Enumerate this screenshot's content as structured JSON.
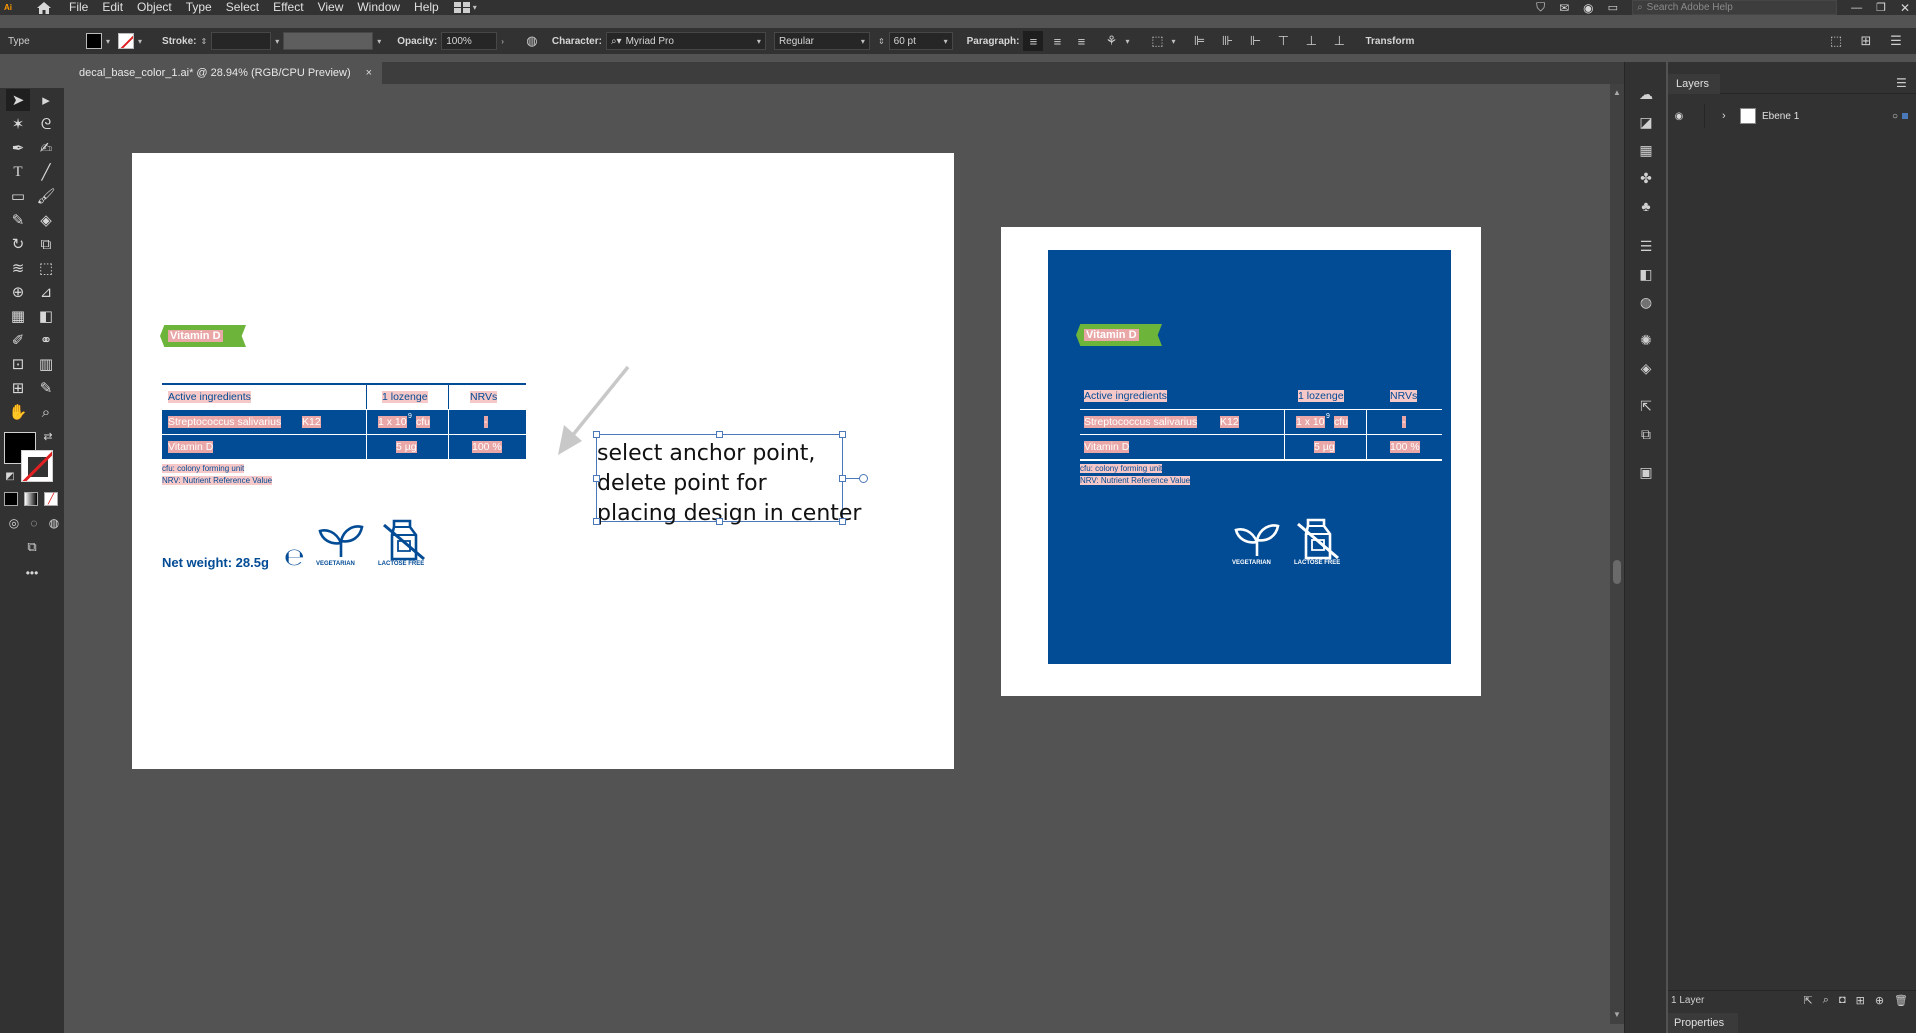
{
  "app": {
    "logo": "Ai",
    "menu": [
      "File",
      "Edit",
      "Object",
      "Type",
      "Select",
      "Effect",
      "View",
      "Window",
      "Help"
    ],
    "search_placeholder": "Search Adobe Help"
  },
  "control_bar": {
    "tool_name": "Type",
    "stroke_label": "Stroke:",
    "opacity_label": "Opacity:",
    "opacity_value": "100%",
    "character_label": "Character:",
    "font_family": "Myriad Pro",
    "font_style": "Regular",
    "font_size": "60 pt",
    "paragraph_label": "Paragraph:",
    "transform_label": "Transform"
  },
  "document": {
    "tab_title": "decal_base_color_1.ai* @ 28.94% (RGB/CPU Preview)",
    "close_glyph": "×"
  },
  "artboard1": {
    "badge": "Vitamin D",
    "table": {
      "headers": [
        "Active ingredients",
        "1 lozenge",
        "NRVs"
      ],
      "rows": [
        [
          "Streptococcus salivarius",
          "K12",
          "1 x 10",
          "9",
          "cfu",
          "‑"
        ],
        [
          "Vitamin D",
          "5 µg",
          "100 %"
        ]
      ]
    },
    "footnote1": "cfu: colony forming unit",
    "footnote2": "NRV: Nutrient Reference Value",
    "net_weight": "Net weight: 28.5g",
    "e_mark": "℮",
    "vegetarian": "VEGETARIAN",
    "lactose_free": "LACTOSE FREE",
    "annotation": [
      "select anchor point,",
      "delete point for",
      "placing design in center"
    ]
  },
  "artboard2": {
    "badge": "Vitamin D",
    "headers": [
      "Active ingredients",
      "1 lozenge",
      "NRVs"
    ],
    "row1": [
      "Streptococcus salivarius",
      "K12",
      "1 x 10",
      "9",
      "cfu",
      "‑"
    ],
    "row2": [
      "Vitamin D",
      "5 µg",
      "100 %"
    ],
    "footnote1": "cfu: colony forming unit",
    "footnote2": "NRV: Nutrient Reference Value",
    "vegetarian": "VEGETARIAN",
    "lactose_free": "LACTOSE FREE"
  },
  "layers_panel": {
    "tab": "Layers",
    "layer_name": "Ebene 1",
    "footer_count": "1 Layer",
    "properties_tab": "Properties"
  },
  "colors": {
    "brand_blue": "#024b95",
    "badge_green": "#6cb53a",
    "ui_dark": "#323232",
    "canvas_gray": "#535353",
    "selection_blue": "#4a78b8"
  }
}
